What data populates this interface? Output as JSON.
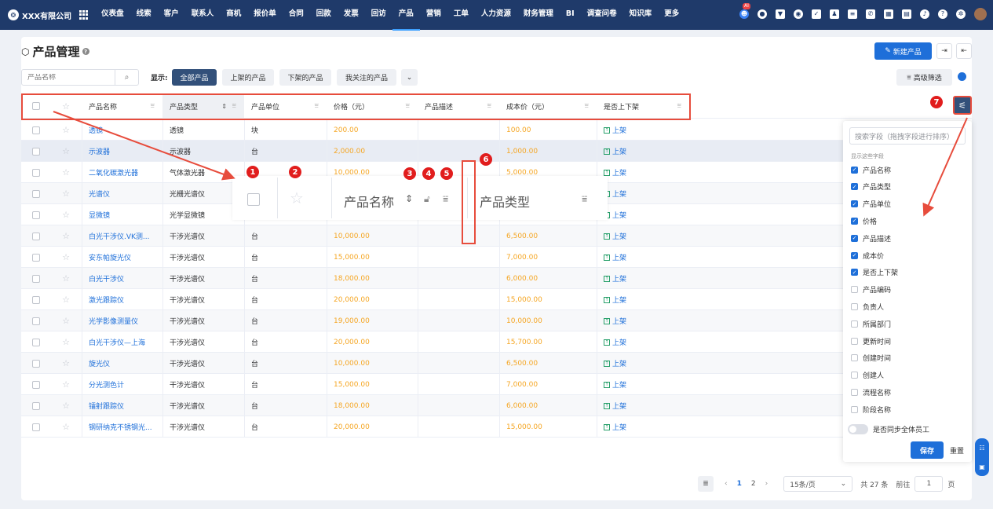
{
  "brand": {
    "name": "XXX有限公司"
  },
  "nav": [
    "仪表盘",
    "线索",
    "客户",
    "联系人",
    "商机",
    "报价单",
    "合同",
    "回款",
    "发票",
    "回访",
    "产品",
    "营销",
    "工单",
    "人力资源",
    "财务管理",
    "BI",
    "调查问卷",
    "知识库",
    "更多"
  ],
  "nav_active": "产品",
  "top_icons": [
    "robot-icon",
    "chat-icon",
    "flag-icon",
    "globe-icon",
    "check-icon",
    "user-icon",
    "doc-icon",
    "phone-icon",
    "calendar-icon",
    "file-icon",
    "bell-icon",
    "help-icon",
    "gear-icon"
  ],
  "ai_badge": "AI",
  "page": {
    "title": "产品管理",
    "new_label": "新建产品"
  },
  "search": {
    "placeholder": "产品名称"
  },
  "filter": {
    "show_label": "显示:",
    "tabs": [
      "全部产品",
      "上架的产品",
      "下架的产品",
      "我关注的产品"
    ],
    "active": 0,
    "advanced": "高级筛选"
  },
  "columns": [
    "产品名称",
    "产品类型",
    "产品单位",
    "价格（元）",
    "产品描述",
    "成本价（元）",
    "是否上下架"
  ],
  "rows": [
    {
      "name": "透镜",
      "type": "透镜",
      "unit": "块",
      "price": "200.00",
      "desc": "",
      "cost": "100.00",
      "shelf": "上架"
    },
    {
      "name": "示波器",
      "type": "示波器",
      "unit": "台",
      "price": "2,000.00",
      "desc": "",
      "cost": "1,000.00",
      "shelf": "上架"
    },
    {
      "name": "二氧化碳激光器",
      "type": "气体激光器",
      "unit": "",
      "price": "10,000.00",
      "desc": "",
      "cost": "5,000.00",
      "shelf": "上架"
    },
    {
      "name": "光谱仪",
      "type": "光栅光谱仪",
      "unit": "",
      "price": "",
      "desc": "",
      "cost": "",
      "shelf": "上架"
    },
    {
      "name": "显微镜",
      "type": "光学显微镜",
      "unit": "",
      "price": "",
      "desc": "",
      "cost": "",
      "shelf": "上架"
    },
    {
      "name": "白光干涉仪.VK测...",
      "type": "干涉光谱仪",
      "unit": "台",
      "price": "10,000.00",
      "desc": "",
      "cost": "6,500.00",
      "shelf": "上架"
    },
    {
      "name": "安东帕旋光仪",
      "type": "干涉光谱仪",
      "unit": "台",
      "price": "15,000.00",
      "desc": "",
      "cost": "7,000.00",
      "shelf": "上架"
    },
    {
      "name": "白光干涉仪",
      "type": "干涉光谱仪",
      "unit": "台",
      "price": "18,000.00",
      "desc": "",
      "cost": "6,000.00",
      "shelf": "上架"
    },
    {
      "name": "激光跟踪仪",
      "type": "干涉光谱仪",
      "unit": "台",
      "price": "20,000.00",
      "desc": "",
      "cost": "15,000.00",
      "shelf": "上架"
    },
    {
      "name": "光学影像测量仪",
      "type": "干涉光谱仪",
      "unit": "台",
      "price": "19,000.00",
      "desc": "",
      "cost": "10,000.00",
      "shelf": "上架"
    },
    {
      "name": "白光干涉仪—上海",
      "type": "干涉光谱仪",
      "unit": "台",
      "price": "20,000.00",
      "desc": "",
      "cost": "15,700.00",
      "shelf": "上架"
    },
    {
      "name": "旋光仪",
      "type": "干涉光谱仪",
      "unit": "台",
      "price": "10,000.00",
      "desc": "",
      "cost": "6,500.00",
      "shelf": "上架"
    },
    {
      "name": "分光测色计",
      "type": "干涉光谱仪",
      "unit": "台",
      "price": "15,000.00",
      "desc": "",
      "cost": "7,000.00",
      "shelf": "上架"
    },
    {
      "name": "镭射跟踪仪",
      "type": "干涉光谱仪",
      "unit": "台",
      "price": "18,000.00",
      "desc": "",
      "cost": "6,000.00",
      "shelf": "上架"
    },
    {
      "name": "钢研纳克不锈钢光...",
      "type": "干涉光谱仪",
      "unit": "台",
      "price": "20,000.00",
      "desc": "",
      "cost": "15,000.00",
      "shelf": "上架"
    }
  ],
  "zoom": {
    "col1": "产品名称",
    "col2": "产品类型"
  },
  "badges": [
    "1",
    "2",
    "3",
    "4",
    "5",
    "6",
    "7"
  ],
  "field_panel": {
    "search_placeholder": "搜索字段（拖拽字段进行排序）",
    "subtitle": "显示这些字段",
    "fields": [
      {
        "label": "产品名称",
        "checked": true
      },
      {
        "label": "产品类型",
        "checked": true
      },
      {
        "label": "产品单位",
        "checked": true
      },
      {
        "label": "价格",
        "checked": true
      },
      {
        "label": "产品描述",
        "checked": true
      },
      {
        "label": "成本价",
        "checked": true
      },
      {
        "label": "是否上下架",
        "checked": true
      },
      {
        "label": "产品编码",
        "checked": false
      },
      {
        "label": "负责人",
        "checked": false
      },
      {
        "label": "所属部门",
        "checked": false
      },
      {
        "label": "更新时间",
        "checked": false
      },
      {
        "label": "创建时间",
        "checked": false
      },
      {
        "label": "创建人",
        "checked": false
      },
      {
        "label": "流程名称",
        "checked": false
      },
      {
        "label": "阶段名称",
        "checked": false
      }
    ],
    "sync_label": "是否同步全体员工",
    "save_label": "保存",
    "reset_label": "重置"
  },
  "pagination": {
    "pages": [
      "1",
      "2"
    ],
    "current": "1",
    "page_size": "15条/页",
    "total": "共 27 条",
    "goto_label": "前往",
    "goto_value": "1",
    "page_unit": "页"
  },
  "colors": {
    "topbar": "#1f3a6a",
    "primary": "#1e6fd9",
    "tab_active": "#32507a",
    "price": "#f5a623",
    "annotation": "#e74c3c"
  }
}
